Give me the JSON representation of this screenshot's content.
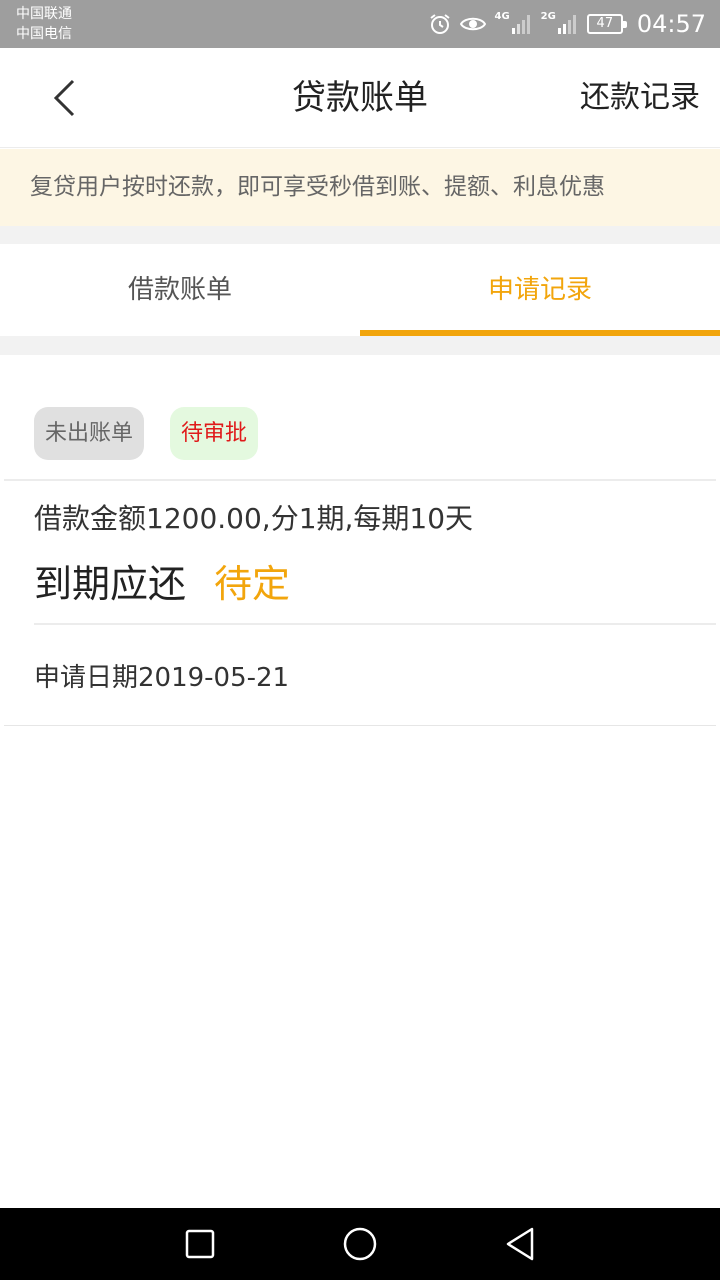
{
  "status_bar": {
    "carrier_1": "中国联通",
    "carrier_2": "中国电信",
    "network_1": "4G",
    "network_2": "2G",
    "battery": "47",
    "time": "04:57",
    "icons": [
      "alarm-icon",
      "eye-icon",
      "signal-icon",
      "battery-icon"
    ]
  },
  "header": {
    "title": "贷款账单",
    "right_link": "还款记录",
    "back_icon": "chevron-left-icon"
  },
  "notice": {
    "text": "复贷用户按时还款，即可享受秒借到账、提额、利息优惠"
  },
  "tabs": [
    {
      "label": "借款账单",
      "active": false
    },
    {
      "label": "申请记录",
      "active": true
    }
  ],
  "record": {
    "badge_status": "未出账单",
    "badge_approval": "待审批",
    "loan_description": "借款金额1200.00,分1期,每期10天",
    "due_label": "到期应还",
    "due_value": "待定",
    "apply_date": "申请日期2019-05-21"
  },
  "nav_bar": {
    "icons": [
      "recents-square-icon",
      "home-circle-icon",
      "back-triangle-icon"
    ]
  },
  "colors": {
    "accent": "#f2a50c",
    "notice_bg": "#fdf6e4",
    "approval_text": "#e01a1a",
    "approval_bg": "#e4f9df",
    "status_bar": "#9e9e9e"
  }
}
